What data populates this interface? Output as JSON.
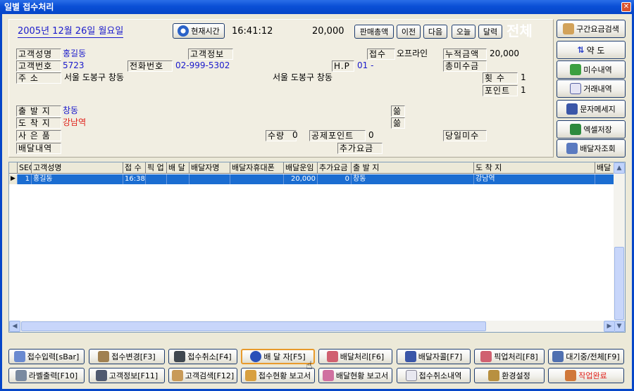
{
  "window": {
    "title": "일별 접수처리"
  },
  "header": {
    "date": "2005년 12월 26일 월요일",
    "current_time_button": "현재시간",
    "time": "16:41:12",
    "total_amount": "20,000",
    "buttons": {
      "sales_total": "판매총액",
      "prev": "이전",
      "next": "다음",
      "today": "오늘",
      "calendar": "달력"
    },
    "all_label": "전체"
  },
  "customer": {
    "name_label": "고객성명",
    "name_value": "홍길동",
    "info_label": "고객정보",
    "receipt_label": "접수",
    "receipt_value": "오프라인",
    "cumulative_label": "누적금액",
    "cumulative_value": "20,000",
    "number_label": "고객번호",
    "number_value": "5723",
    "phone_label": "전화번호",
    "phone_value": "02-999-5302",
    "hp_label": "H.P",
    "hp_value": "01 -",
    "unpaid_total_label": "총미수금",
    "address_label": "주    소",
    "address_value": "서울 도봉구 창동",
    "address_value2": "서울 도봉구 창동",
    "count_label": "횟  수",
    "count_value": "1",
    "point_label": "포인트",
    "point_value": "1"
  },
  "delivery": {
    "origin_label": "출 발 지",
    "origin_value": "창동",
    "dest_label": "도 착 지",
    "dest_value": "강남역",
    "goods_label": "사 은 품",
    "history_label": "배달내역",
    "quantity_label": "수량",
    "quantity_value": "0",
    "deduct_point_label": "공제포인트",
    "deduct_point_value": "0",
    "today_unpaid_label": "당일미수",
    "extra_fee_label": "추가요금",
    "ham_icon": "쓺"
  },
  "side_buttons": {
    "section_search": "구간요금검색",
    "pharmacy": "약 도",
    "unpaid_history": "미수내역",
    "transaction_history": "거래내역",
    "sms": "문자메세지",
    "excel_save": "엑셀저장",
    "courier_search": "배달자조회"
  },
  "grid": {
    "columns": [
      "SEQ",
      "고객성명",
      "접 수",
      "픽 업",
      "배 달",
      "배달자명",
      "배달자휴대폰",
      "배달운임",
      "추가요금",
      "출 발 지",
      "도 착 지",
      "배달"
    ],
    "rows": [
      {
        "seq": "1",
        "name": "홍길동",
        "receipt": "16:38",
        "pickup": "",
        "delivery": "",
        "courier": "",
        "courier_phone": "",
        "fare": "20,000",
        "extra": "0",
        "origin": "창동",
        "dest": "강남역",
        "more": ""
      }
    ]
  },
  "bottom_buttons": [
    "접수입력[sBar]",
    "접수변경[F3]",
    "접수취소[F4]",
    "배 달 자[F5]",
    "배달처리[F6]",
    "배달자콜[F7]",
    "픽업처리[F8]",
    "대기중/전체[F9]",
    "라벨출력[F10]",
    "고객정보[F11]",
    "고객검색[F12]",
    "접수현황 보고서",
    "배달현황 보고서",
    "접수취소내역",
    "환경설정",
    "작업완료"
  ]
}
